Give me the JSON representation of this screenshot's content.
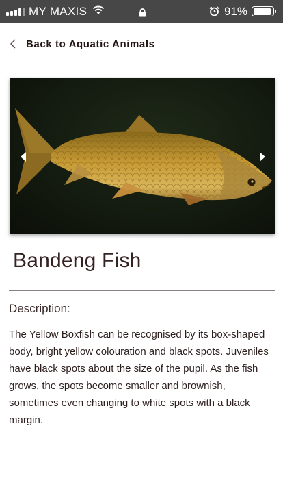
{
  "status_bar": {
    "carrier": "MY MAXIS",
    "battery_percent": "91%",
    "battery_level": 0.91,
    "icons": [
      "signal-icon",
      "wifi-icon",
      "lock-icon",
      "alarm-icon",
      "battery-icon"
    ]
  },
  "nav": {
    "back_label": "Back to Aquatic Animals",
    "back_icon": "chevron-left-icon"
  },
  "gallery": {
    "image_subject": "fish-photo",
    "prev_icon": "arrow-left-icon",
    "next_icon": "arrow-right-icon"
  },
  "animal": {
    "name": "Bandeng Fish",
    "description_heading": "Description:",
    "description": "The Yellow Boxfish can be recognised by its box-shaped body, bright yellow colouration and black spots. Juveniles have black spots about the size of the pupil. As the fish grows, the spots become smaller and brownish, sometimes even changing to white spots with a black margin."
  },
  "colors": {
    "status_bar_bg": "#474747",
    "text": "#2b1b1b",
    "divider": "#8a8080"
  }
}
